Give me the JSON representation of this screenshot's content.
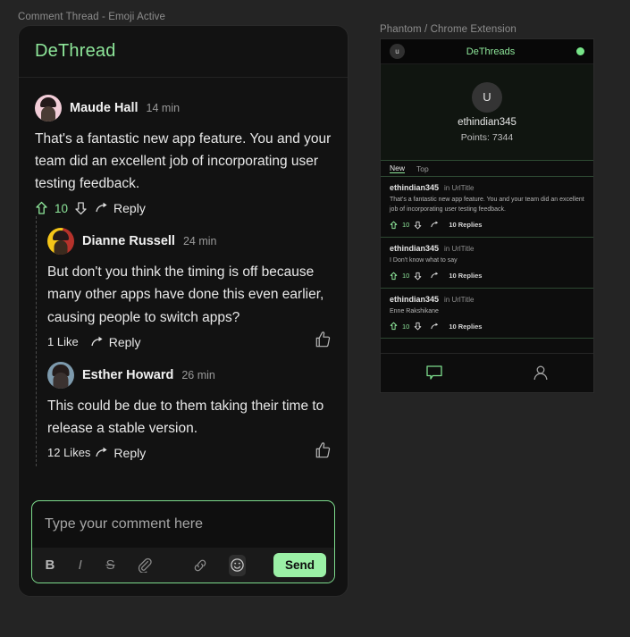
{
  "captions": {
    "thread": "Comment Thread - Emoji Active",
    "extension": "Phantom / Chrome Extension"
  },
  "colors": {
    "accent_green": "#8ee79a",
    "send_button": "#9bf0a6",
    "page_background": "#242424",
    "card_background": "#121212"
  },
  "thread": {
    "brand": "DeThread",
    "comments": [
      {
        "author": "Maude Hall",
        "time": "14 min",
        "text": "That's a fantastic new app feature. You and your team did an excellent job of incorporating user testing feedback.",
        "vote_count": "10",
        "reply_label": "Reply",
        "avatar_icon": "avatar-maude-hall"
      },
      {
        "author": "Dianne Russell",
        "time": "24 min",
        "text": "But don't you think the timing is off because many other apps have done this even earlier, causing people to switch apps?",
        "likes": "1 Like",
        "reply_label": "Reply",
        "avatar_icon": "avatar-dianne-russell"
      },
      {
        "author": "Esther Howard",
        "time": "26 min",
        "text": "This could be due to them taking their time to release a stable version.",
        "likes": "12 Likes",
        "reply_label": "Reply",
        "avatar_icon": "avatar-esther-howard"
      }
    ],
    "composer": {
      "placeholder": "Type your comment here",
      "value": "",
      "bold_label": "B",
      "italic_label": "I",
      "strike_label": "S",
      "send_label": "Send"
    }
  },
  "extension": {
    "topbar": {
      "avatar_initial": "u",
      "title": "DeThreads",
      "status": "online"
    },
    "profile": {
      "avatar_initial": "U",
      "username": "ethindian345",
      "points": "Points: 7344"
    },
    "tabs": [
      {
        "label": "New",
        "active": true
      },
      {
        "label": "Top",
        "active": false
      }
    ],
    "posts": [
      {
        "user": "ethindian345",
        "source": "in UrlTitle",
        "body": "That's a fantastic new app feature. You and your team did an excellent job of incorporating user testing feedback.",
        "vote_count": "10",
        "replies": "10 Replies"
      },
      {
        "user": "ethindian345",
        "source": "in UrlTitle",
        "body": "I Don't know what to say",
        "vote_count": "10",
        "replies": "10 Replies"
      },
      {
        "user": "ethindian345",
        "source": "in UrlTitle",
        "body": "Enne Rakshikane",
        "vote_count": "10",
        "replies": "10 Replies"
      }
    ]
  }
}
